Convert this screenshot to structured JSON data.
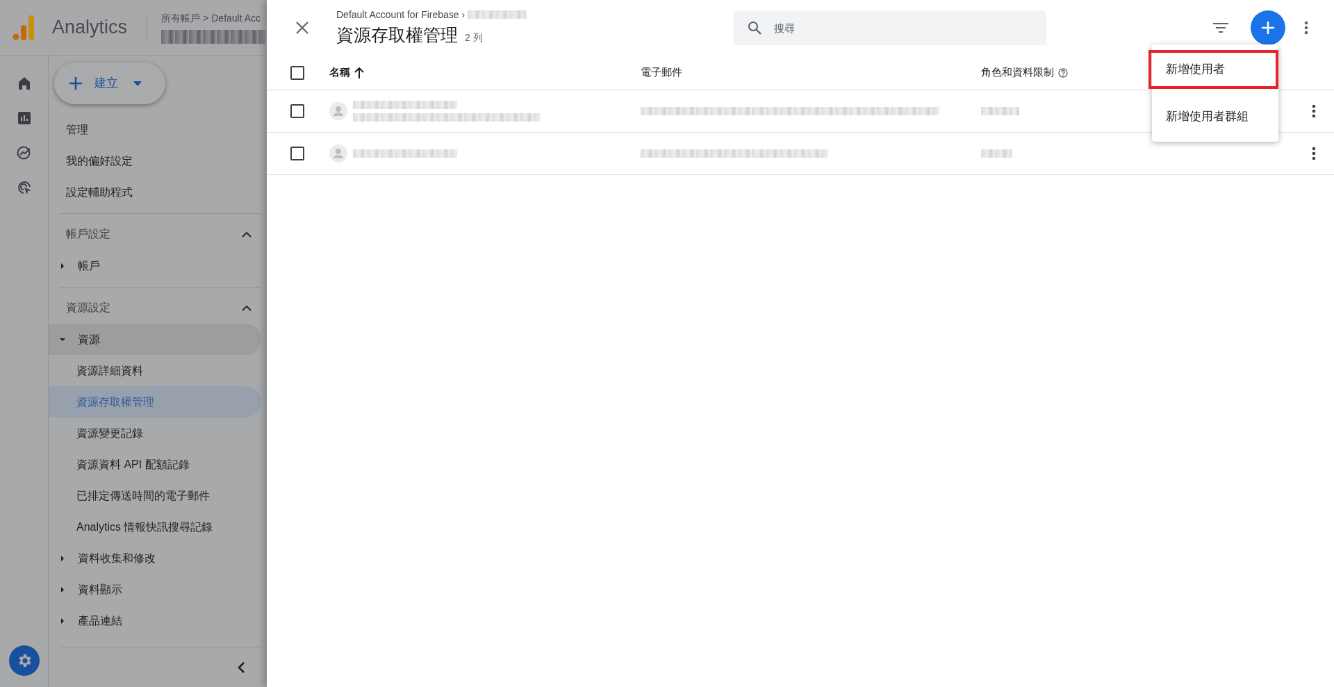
{
  "header": {
    "product": "Analytics",
    "breadcrumb_root": "所有帳戶",
    "breadcrumb_separator": ">",
    "breadcrumb_account": "Default Acc"
  },
  "nav": {
    "create_button": "建立",
    "links": [
      {
        "label": "管理"
      },
      {
        "label": "我的偏好設定"
      },
      {
        "label": "設定輔助程式"
      }
    ],
    "sections": [
      {
        "title": "帳戶設定",
        "expanded": true,
        "items": [
          {
            "label": "帳戶",
            "expanded": false
          }
        ]
      },
      {
        "title": "資源設定",
        "expanded": true,
        "items": [
          {
            "label": "資源",
            "expanded": true,
            "children": [
              {
                "label": "資源詳細資料",
                "selected": false
              },
              {
                "label": "資源存取權管理",
                "selected": true
              },
              {
                "label": "資源變更記錄",
                "selected": false
              },
              {
                "label": "資源資料 API 配額記錄",
                "selected": false
              },
              {
                "label": "已排定傳送時間的電子郵件",
                "selected": false
              },
              {
                "label": "Analytics 情報快訊搜尋記錄",
                "selected": false
              }
            ]
          },
          {
            "label": "資料收集和修改",
            "expanded": false
          },
          {
            "label": "資料顯示",
            "expanded": false
          },
          {
            "label": "產品連結",
            "expanded": false
          }
        ]
      }
    ]
  },
  "panel": {
    "breadcrumb": "Default Account for Firebase ›",
    "title": "資源存取權管理",
    "count": "2 列",
    "search": {
      "placeholder": "搜尋"
    },
    "select_all_checked": false,
    "columns": [
      {
        "label": "名稱",
        "sorted": true,
        "help": false
      },
      {
        "label": "電子郵件",
        "sorted": false,
        "help": false
      },
      {
        "label": "角色和資料限制",
        "sorted": false,
        "help": true
      }
    ],
    "rows": [
      {
        "checked": false,
        "kind": "two-line"
      },
      {
        "checked": false,
        "kind": "one-line"
      }
    ],
    "menu": [
      {
        "label": "新增使用者",
        "highlighted": true
      },
      {
        "label": "新增使用者群組",
        "highlighted": false
      }
    ]
  }
}
